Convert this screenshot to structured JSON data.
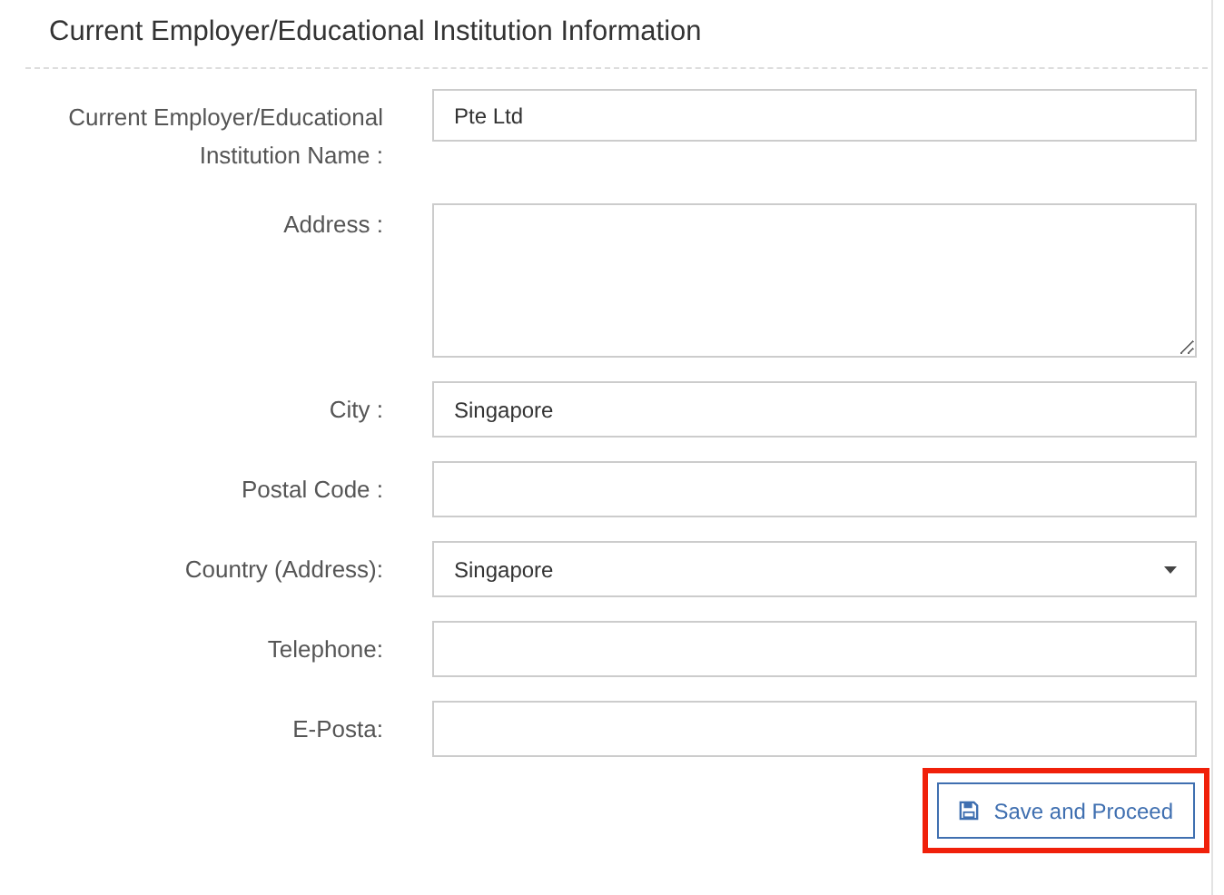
{
  "section": {
    "title": "Current Employer/Educational Institution Information"
  },
  "fields": [
    {
      "kind": "text",
      "label": "Current Employer/Educational Institution Name :",
      "value": "Pte Ltd"
    },
    {
      "kind": "textarea",
      "label": "Address :"
    },
    {
      "kind": "text",
      "label": "City :",
      "value": "Singapore"
    },
    {
      "kind": "text",
      "label": "Postal Code :"
    },
    {
      "kind": "select",
      "label": "Country (Address):",
      "value": "Singapore"
    },
    {
      "kind": "text",
      "label": "Telephone:"
    },
    {
      "kind": "text",
      "label": "E-Posta:"
    }
  ],
  "save_button": {
    "label": "Save and Proceed",
    "highlighted": true
  }
}
